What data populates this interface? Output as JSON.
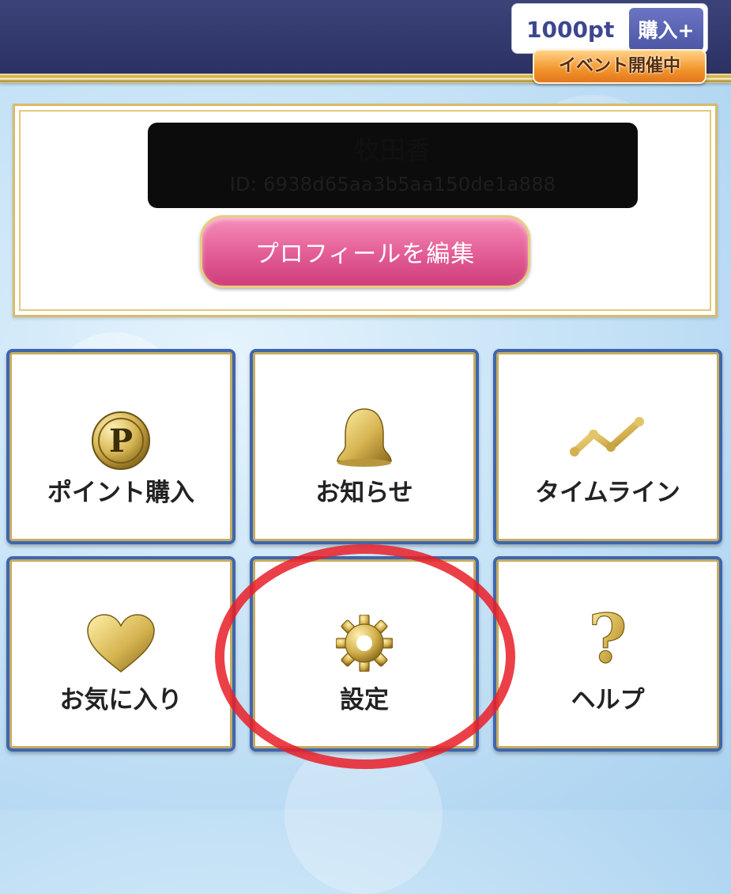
{
  "header": {
    "points": "1000pt",
    "buy_label": "購入+",
    "event_badge": "イベント開催中"
  },
  "profile": {
    "name": "牧田香",
    "id_text": "ID: 6938d65aa3b5aa150de1a888",
    "edit_label": "プロフィールを編集"
  },
  "menu": [
    {
      "label": "ポイント購入",
      "icon": "p-coin-icon"
    },
    {
      "label": "お知らせ",
      "icon": "bell-icon"
    },
    {
      "label": "タイムライン",
      "icon": "timeline-icon"
    },
    {
      "label": "お気に入り",
      "icon": "heart-icon"
    },
    {
      "label": "設定",
      "icon": "gear-icon"
    },
    {
      "label": "ヘルプ",
      "icon": "question-icon"
    }
  ],
  "colors": {
    "header": "#2f356b",
    "tile_border": "#3f66ad",
    "gold": "#c9a642",
    "edit_button": "#e25c95",
    "highlight": "#e91e28"
  }
}
